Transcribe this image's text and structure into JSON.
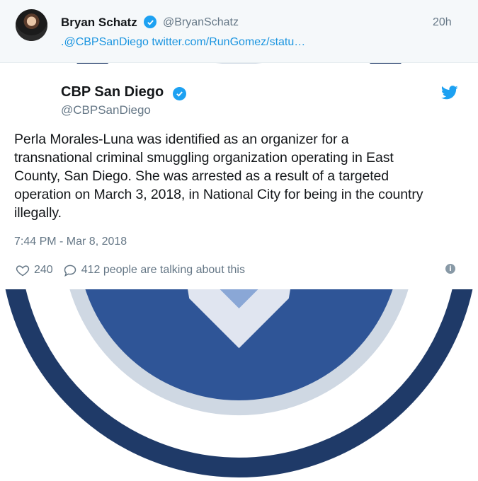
{
  "reply_tweet": {
    "name": "Bryan Schatz",
    "handle": "@BryanSchatz",
    "time": "20h",
    "mention": ".@CBPSanDiego",
    "link_text": "twitter.com/RunGomez/statu…"
  },
  "embedded_tweet": {
    "name": "CBP San Diego",
    "handle": "@CBPSanDiego",
    "text_lines": [
      "Perla Morales-Luna was identified as an organizer for a",
      "transnational criminal smuggling organization operating in East",
      "County, San Diego.  She was arrested as a result of a targeted",
      "operation on March 3, 2018, in National City for being in the country",
      "illegally."
    ],
    "timestamp": "7:44 PM - Mar 8, 2018",
    "like_count": "240",
    "talking_text": "412 people are talking about this"
  },
  "icons": {
    "verified": "verified-badge-icon",
    "bird": "twitter-bird-icon",
    "like": "heart-icon",
    "reply": "speech-bubble-icon",
    "info": "info-icon"
  },
  "colors": {
    "accent": "#1da1f2",
    "link": "#1b95e0",
    "muted": "#657786",
    "reply_bg": "#f5f8fa"
  }
}
